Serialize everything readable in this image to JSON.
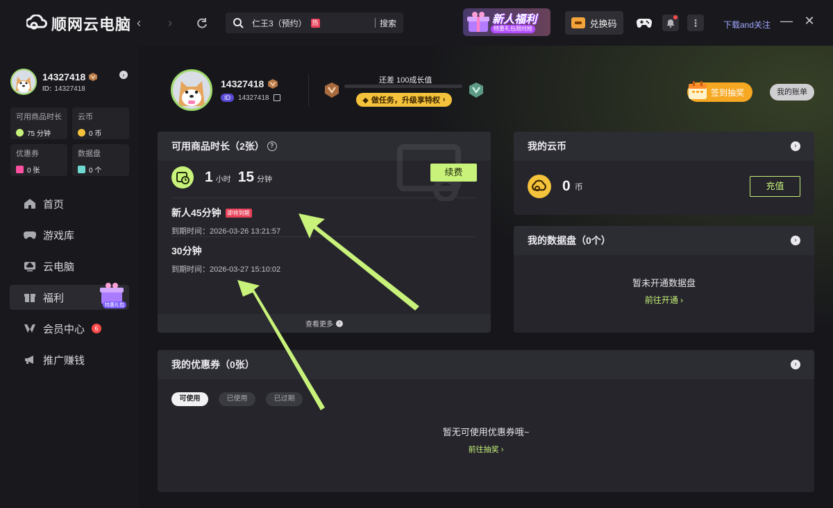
{
  "app": {
    "logo_text": "顺网云电脑"
  },
  "topbar": {
    "search_text": "仁王3（预约）",
    "hot_label": "热",
    "search_button": "搜索",
    "promo_title": "新人福利",
    "promo_sub": "特惠礼包限时抢",
    "exchange_label": "兑换码",
    "download_label": "下载and关注"
  },
  "sidebar": {
    "username": "14327418",
    "id_label": "ID:",
    "id_value": "14327418",
    "stats": [
      {
        "label": "可用商品时长",
        "value": "75 分钟",
        "color": "#c8f27a"
      },
      {
        "label": "云币",
        "value": "0 币",
        "color": "#f5c23b"
      },
      {
        "label": "优惠券",
        "value": "0 张",
        "color": "#ff4fa0"
      },
      {
        "label": "数据盘",
        "value": "0 个",
        "color": "#6fd8d0"
      }
    ],
    "menu": [
      {
        "label": "首页",
        "icon": "home-icon"
      },
      {
        "label": "游戏库",
        "icon": "gamepad-icon"
      },
      {
        "label": "云电脑",
        "icon": "cloud-pc-icon"
      },
      {
        "label": "福利",
        "icon": "gift-icon",
        "deco_label": "特惠礼包"
      },
      {
        "label": "会员中心",
        "icon": "vip-icon",
        "badge": "6"
      },
      {
        "label": "推广赚钱",
        "icon": "megaphone-icon"
      }
    ]
  },
  "profile": {
    "username": "14327418",
    "id_tag": "ID",
    "id_value": "14327418",
    "growth_text": "还差 100成长值",
    "growth_progress": 0,
    "task_label": "做任务，升级享特权",
    "signin_label": "签到抽奖",
    "bill_label": "我的账单"
  },
  "duration_panel": {
    "title": "可用商品时长（2张）",
    "hours": "1",
    "hours_unit": "小时",
    "minutes": "15",
    "minutes_unit": "分钟",
    "renew_label": "续费",
    "tickets": [
      {
        "title": "新人45分钟",
        "tag": "即将到期",
        "expire": "到期时间：2026-03-26 13:21:57"
      },
      {
        "title": "30分钟",
        "tag": "",
        "expire": "到期时间：2026-03-27 15:10:02"
      }
    ],
    "more_label": "查看更多"
  },
  "coin_panel": {
    "title": "我的云币",
    "value": "0",
    "unit": "币",
    "recharge_label": "充值"
  },
  "disk_panel": {
    "title": "我的数据盘（0个）",
    "empty_text": "暂未开通数据盘",
    "link_label": "前往开通"
  },
  "coupon_panel": {
    "title": "我的优惠券（0张）",
    "chips": [
      "可使用",
      "已使用",
      "已过期"
    ],
    "empty_text": "暂无可使用优惠券哦~",
    "link_label": "前往抽奖"
  },
  "colors": {
    "accent": "#c8f27a",
    "gold": "#f5c23b",
    "badge_red": "#e8425a"
  }
}
